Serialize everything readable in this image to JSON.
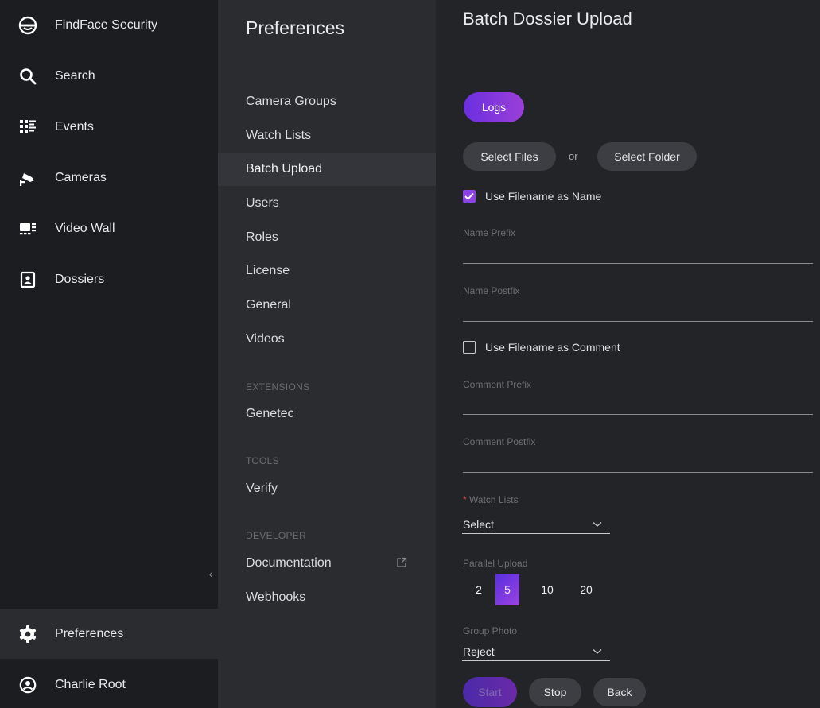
{
  "app": {
    "name": "FindFace Security"
  },
  "sidebar": {
    "items": [
      {
        "label": "Search",
        "icon": "search-icon"
      },
      {
        "label": "Events",
        "icon": "events-icon"
      },
      {
        "label": "Cameras",
        "icon": "camera-icon"
      },
      {
        "label": "Video Wall",
        "icon": "video-wall-icon"
      },
      {
        "label": "Dossiers",
        "icon": "dossiers-icon"
      }
    ],
    "collapse_glyph": "‹",
    "preferences_label": "Preferences",
    "user_label": "Charlie Root"
  },
  "preferences": {
    "title": "Preferences",
    "items": [
      {
        "label": "Camera Groups"
      },
      {
        "label": "Watch Lists"
      },
      {
        "label": "Batch Upload",
        "active": true
      },
      {
        "label": "Users"
      },
      {
        "label": "Roles"
      },
      {
        "label": "License"
      },
      {
        "label": "General"
      },
      {
        "label": "Videos"
      }
    ],
    "extensions_header": "EXTENSIONS",
    "extensions": [
      {
        "label": "Genetec"
      }
    ],
    "tools_header": "TOOLS",
    "tools": [
      {
        "label": "Verify"
      }
    ],
    "developer_header": "DEVELOPER",
    "developer": [
      {
        "label": "Documentation"
      },
      {
        "label": "Webhooks"
      }
    ]
  },
  "main": {
    "title": "Batch Dossier Upload",
    "logs_label": "Logs",
    "select_files_label": "Select Files",
    "or_label": "or",
    "select_folder_label": "Select Folder",
    "use_filename_name": {
      "label": "Use Filename as Name",
      "checked": true
    },
    "name_prefix": {
      "label": "Name Prefix",
      "value": ""
    },
    "name_postfix": {
      "label": "Name Postfix",
      "value": ""
    },
    "use_filename_comment": {
      "label": "Use Filename as Comment",
      "checked": false
    },
    "comment_prefix": {
      "label": "Comment Prefix",
      "value": ""
    },
    "comment_postfix": {
      "label": "Comment Postfix",
      "value": ""
    },
    "watch_lists": {
      "required_mark": "*",
      "label": "Watch Lists",
      "value": "Select"
    },
    "parallel_upload": {
      "label": "Parallel Upload",
      "options": [
        "2",
        "5",
        "10",
        "20"
      ],
      "selected": "5"
    },
    "group_photo": {
      "label": "Group Photo",
      "value": "Reject"
    },
    "start_label": "Start",
    "stop_label": "Stop",
    "back_label": "Back"
  },
  "colors": {
    "accent": "#8b43e6",
    "sidebar_bg": "#1c1d20",
    "panel_bg": "#2b2c30",
    "main_bg": "#232427"
  }
}
